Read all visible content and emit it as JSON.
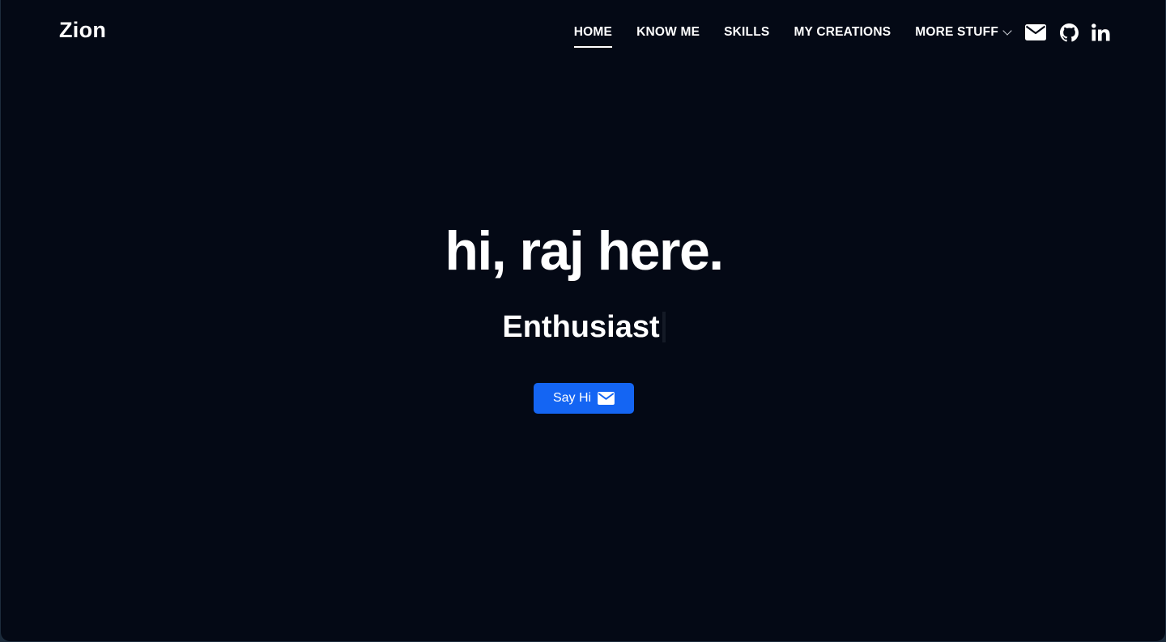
{
  "brand": {
    "name": "Zion"
  },
  "nav": {
    "items": [
      {
        "label": "HOME",
        "active": true
      },
      {
        "label": "KNOW ME",
        "active": false
      },
      {
        "label": "SKILLS",
        "active": false
      },
      {
        "label": "MY CREATIONS",
        "active": false
      }
    ],
    "dropdown": {
      "label": "MORE STUFF",
      "icon": "chevron-down-icon"
    },
    "social_icons": [
      "mail-icon",
      "github-icon",
      "linkedin-icon"
    ]
  },
  "hero": {
    "title": "hi, raj here.",
    "typed_text": "Enthusiast",
    "cta": {
      "label": "Say Hi",
      "icon": "mail-icon"
    }
  },
  "colors": {
    "background": "#040915",
    "text": "#ffffff",
    "accent": "#1465f3"
  }
}
